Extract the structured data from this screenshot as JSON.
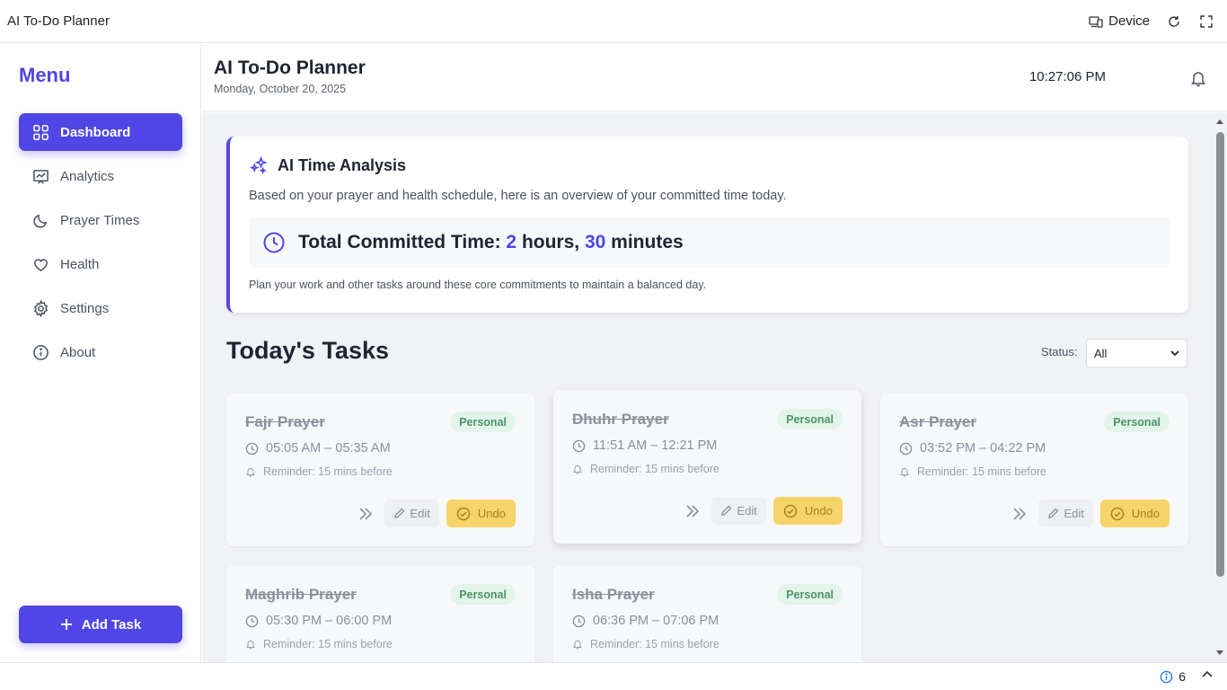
{
  "window": {
    "title": "AI To-Do Planner",
    "device_label": "Device"
  },
  "sidebar": {
    "menu_title": "Menu",
    "items": [
      {
        "label": "Dashboard",
        "icon": "grid-icon",
        "active": true
      },
      {
        "label": "Analytics",
        "icon": "chart-icon",
        "active": false
      },
      {
        "label": "Prayer Times",
        "icon": "moon-icon",
        "active": false
      },
      {
        "label": "Health",
        "icon": "heart-icon",
        "active": false
      },
      {
        "label": "Settings",
        "icon": "gear-icon",
        "active": false
      },
      {
        "label": "About",
        "icon": "info-icon",
        "active": false
      }
    ],
    "add_task_label": "Add Task"
  },
  "header": {
    "title": "AI To-Do Planner",
    "date": "Monday, October 20, 2025",
    "clock": "10:27:06 PM"
  },
  "analysis": {
    "title": "AI Time Analysis",
    "description": "Based on your prayer and health schedule, here is an overview of your committed time today.",
    "total_prefix": "Total Committed Time:",
    "hours": "2",
    "hours_unit": "hours,",
    "minutes": "30",
    "minutes_unit": "minutes",
    "footer": "Plan your work and other tasks around these core commitments to maintain a balanced day."
  },
  "tasks_section": {
    "title": "Today's Tasks",
    "status_label": "Status:",
    "status_value": "All"
  },
  "tasks": [
    {
      "name": "Fajr Prayer",
      "category": "Personal",
      "time": "05:05 AM – 05:35 AM",
      "reminder": "Reminder: 15 mins before",
      "edit_label": "Edit",
      "undo_label": "Undo"
    },
    {
      "name": "Dhuhr Prayer",
      "category": "Personal",
      "time": "11:51 AM – 12:21 PM",
      "reminder": "Reminder: 15 mins before",
      "edit_label": "Edit",
      "undo_label": "Undo"
    },
    {
      "name": "Asr Prayer",
      "category": "Personal",
      "time": "03:52 PM – 04:22 PM",
      "reminder": "Reminder: 15 mins before",
      "edit_label": "Edit",
      "undo_label": "Undo"
    },
    {
      "name": "Maghrib Prayer",
      "category": "Personal",
      "time": "05:30 PM – 06:00 PM",
      "reminder": "Reminder: 15 mins before"
    },
    {
      "name": "Isha Prayer",
      "category": "Personal",
      "time": "06:36 PM – 07:06 PM",
      "reminder": "Reminder: 15 mins before"
    }
  ],
  "status_bar": {
    "info_count": "6"
  },
  "colors": {
    "accent": "#4f46e5",
    "badge_bg": "#e3f4ea",
    "badge_text": "#4a9466",
    "undo_bg": "#f7d46a"
  }
}
